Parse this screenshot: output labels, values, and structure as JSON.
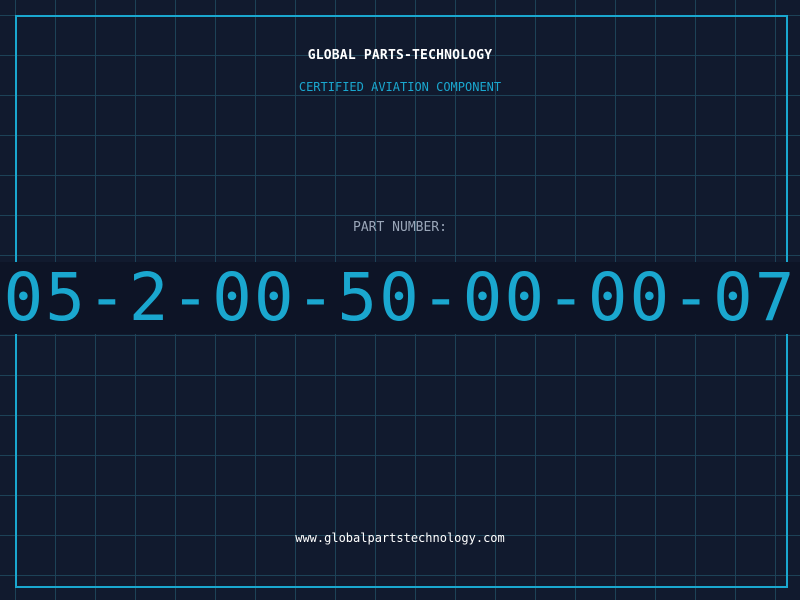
{
  "header": {
    "brand": "GLOBAL PARTS-TECHNOLOGY",
    "subtitle": "CERTIFIED AVIATION COMPONENT"
  },
  "part": {
    "label": "PART NUMBER:",
    "number": "05-2-00-50-00-00-07"
  },
  "footer": {
    "url": "www.globalpartstechnology.com"
  },
  "colors": {
    "background": "#111a2e",
    "grid": "#1d4257",
    "accent": "#1aa7cf",
    "band": "#0d1426",
    "label": "#9aa6b8",
    "text": "#ffffff"
  }
}
